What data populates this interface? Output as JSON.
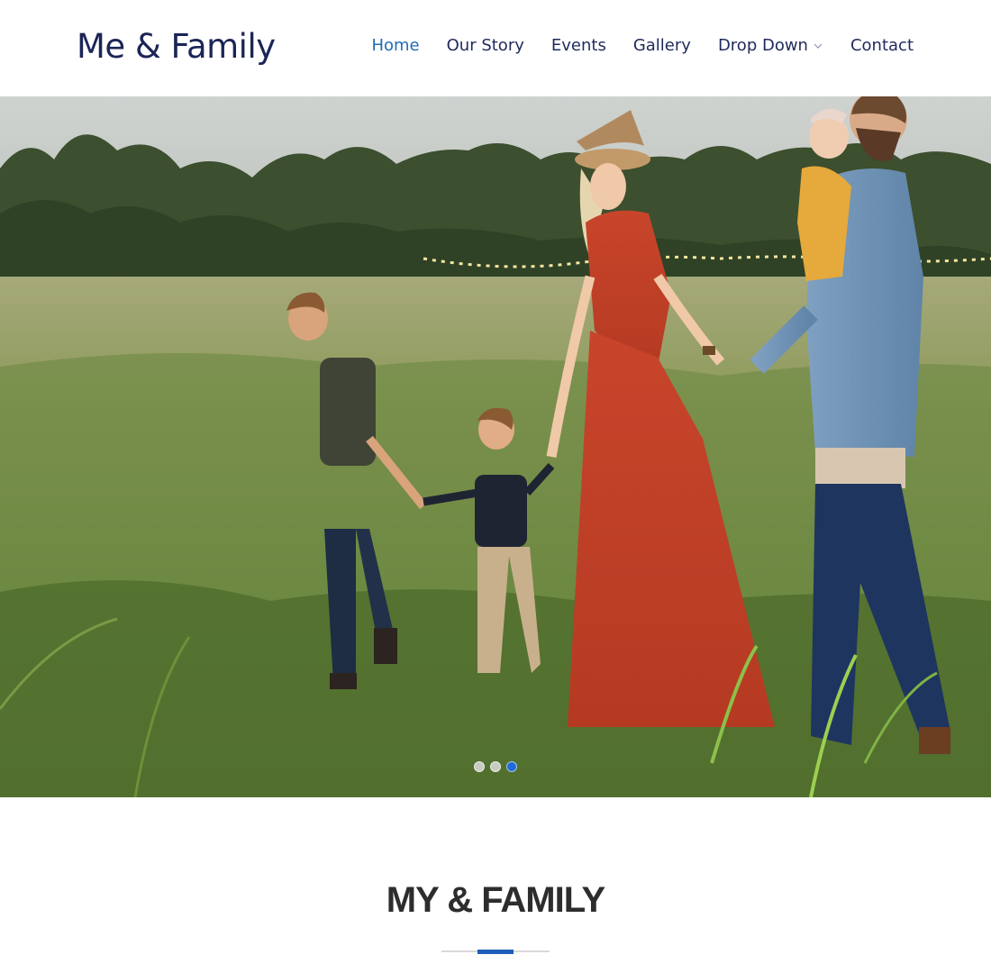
{
  "site": {
    "logo": "Me & Family"
  },
  "nav": {
    "items": [
      {
        "label": "Home",
        "active": true
      },
      {
        "label": "Our Story",
        "active": false
      },
      {
        "label": "Events",
        "active": false
      },
      {
        "label": "Gallery",
        "active": false
      },
      {
        "label": "Drop Down",
        "active": false,
        "has_dropdown": true
      },
      {
        "label": "Contact",
        "active": false
      }
    ]
  },
  "hero": {
    "slides": 3,
    "active_slide": 3
  },
  "section": {
    "title": "MY & FAMILY"
  },
  "colors": {
    "brand_text": "#1c2557",
    "nav_active": "#1f6bb8",
    "accent": "#1f5fb8",
    "heading": "#2d2d2d"
  }
}
